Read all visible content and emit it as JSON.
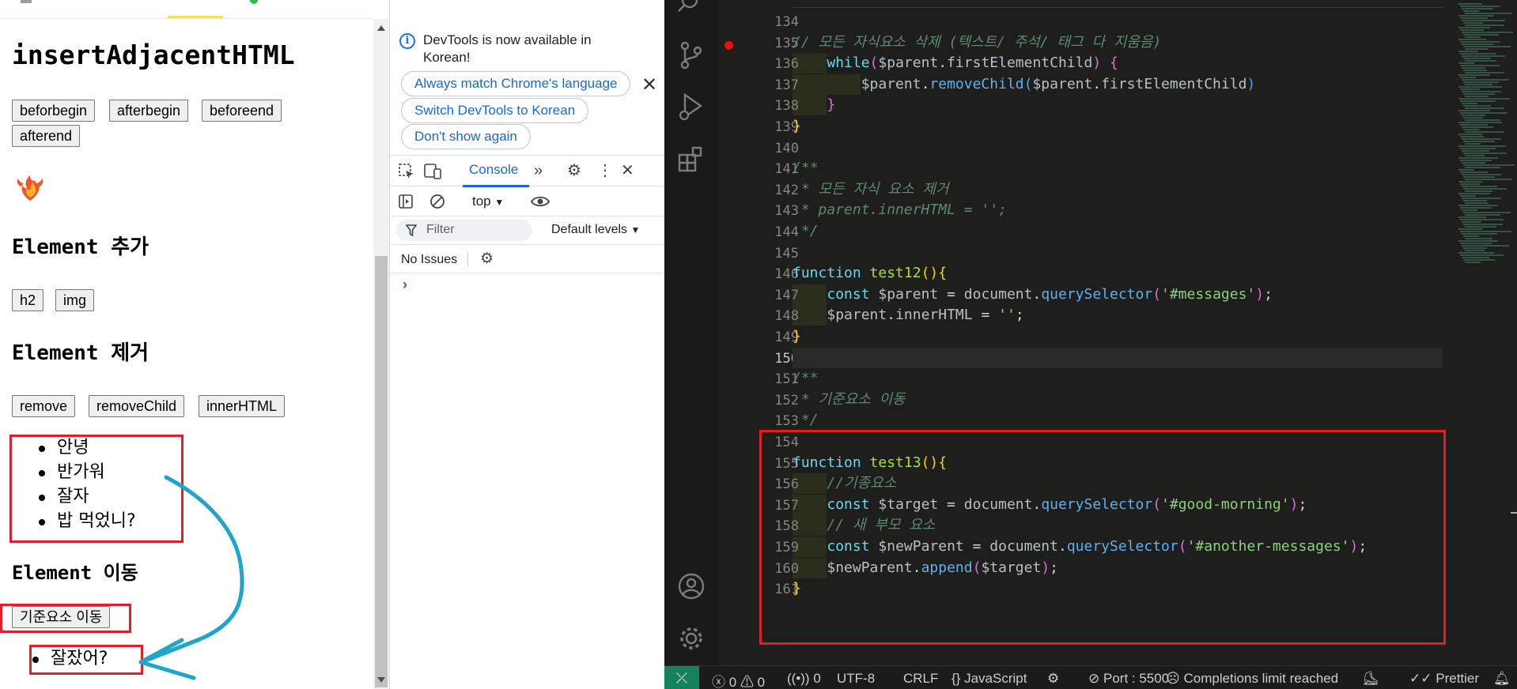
{
  "browser_page": {
    "heading_insert": "insertAdjacentHTML",
    "insert_buttons": [
      "beforbegin",
      "afterbegin",
      "beforeend",
      "afterend"
    ],
    "heading_add": "Element 추가",
    "add_buttons": [
      "h2",
      "img"
    ],
    "heading_remove": "Element 제거",
    "remove_buttons": [
      "remove",
      "removeChild",
      "innerHTML"
    ],
    "messages": [
      "안녕",
      "반가워",
      "잘자",
      "밥 먹었니?"
    ],
    "heading_move": "Element 이동",
    "move_button": "기준요소 이동",
    "another_messages": [
      "잘잤어?"
    ]
  },
  "devtools": {
    "notice_text": "DevTools is now available in Korean!",
    "notice_buttons": [
      "Always match Chrome's language",
      "Switch DevTools to Korean",
      "Don't show again"
    ],
    "tab_console": "Console",
    "context": "top",
    "filter_placeholder": "Filter",
    "levels": "Default levels",
    "issues": "No Issues"
  },
  "editor": {
    "lines": [
      {
        "n": "134",
        "html": ""
      },
      {
        "n": "135",
        "html": "<span class='cm'>// 모든 자식요소 삭제 (텍스트/ 주석/ 태그 다 지움음)</span>"
      },
      {
        "n": "136",
        "html": "    <span class='kw'>while</span><span class='br2'>(</span><span class='var'>$parent</span>.<span class='var'>firstElementChild</span><span class='br2'>)</span> <span class='br2'>{</span>"
      },
      {
        "n": "137",
        "html": "        <span class='var'>$parent</span>.<span class='fnb'>removeChild</span><span class='br3'>(</span><span class='var'>$parent</span>.<span class='var'>firstElementChild</span><span class='br3'>)</span>"
      },
      {
        "n": "138",
        "html": "    <span class='br2'>}</span>"
      },
      {
        "n": "139",
        "html": "<span class='br1'>}</span>"
      },
      {
        "n": "140",
        "html": ""
      },
      {
        "n": "141",
        "html": "<span class='cm'>/**</span>"
      },
      {
        "n": "142",
        "html": "<span class='cm'> * 모든 자식 요소 제거</span>"
      },
      {
        "n": "143",
        "html": "<span class='cm'> * parent.innerHTML = '';</span>"
      },
      {
        "n": "144",
        "html": "<span class='cm'> */</span>"
      },
      {
        "n": "145",
        "html": ""
      },
      {
        "n": "146",
        "html": "<span class='kw2'>function</span> <span class='fn'>test12</span><span class='br1'>(){</span>"
      },
      {
        "n": "147",
        "html": "    <span class='kw'>const</span> <span class='var'>$parent</span> = <span class='var'>document</span>.<span class='fnb'>querySelector</span><span class='br2'>(</span><span class='str'>'#messages'</span><span class='br2'>)</span>;"
      },
      {
        "n": "148",
        "html": "    <span class='var'>$parent</span>.<span class='var'>innerHTML</span> = <span class='str'>''</span>;"
      },
      {
        "n": "149",
        "html": "<span class='br1'>}</span>"
      },
      {
        "n": "150",
        "html": ""
      },
      {
        "n": "151",
        "html": "<span class='cm'>/**</span>"
      },
      {
        "n": "152",
        "html": "<span class='cm'> * 기준요소 이동</span>"
      },
      {
        "n": "153",
        "html": "<span class='cm'> */</span>"
      },
      {
        "n": "154",
        "html": ""
      },
      {
        "n": "155",
        "html": "<span class='kw2'>function</span> <span class='fn'>test13</span><span class='br1'>(){</span>"
      },
      {
        "n": "156",
        "html": "    <span class='cm'>//기종요소</span>"
      },
      {
        "n": "157",
        "html": "    <span class='kw'>const</span> <span class='var'>$target</span> = <span class='var'>document</span>.<span class='fnb'>querySelector</span><span class='br2'>(</span><span class='str'>'#good-morning'</span><span class='br2'>)</span>;"
      },
      {
        "n": "158",
        "html": "    <span class='cm'>// 새 부모 요소</span>"
      },
      {
        "n": "159",
        "html": "    <span class='kw'>const</span> <span class='var'>$newParent</span> = <span class='var'>document</span>.<span class='fnb'>querySelector</span><span class='br2'>(</span><span class='str'>'#another-messages'</span><span class='br2'>)</span>;"
      },
      {
        "n": "160",
        "html": "    <span class='var'>$newParent</span>.<span class='fnb'>append</span><span class='br2'>(</span><span class='var'>$target</span><span class='br2'>)</span>;"
      },
      {
        "n": "161",
        "html": "<span class='br1'>}</span>"
      }
    ],
    "active_line": "150",
    "breakpoint_line": "135"
  },
  "statusbar": {
    "problems": "0",
    "warnings": "0",
    "ports_forwarded": "0",
    "encoding": "UTF-8",
    "eol": "CRLF",
    "language": "JavaScript",
    "port": "Port : 5500",
    "completions": "Completions limit reached",
    "prettier": "Prettier"
  },
  "colors": {
    "annotation_red": "#e01f26",
    "arrow_blue": "#1ea5c9",
    "accent_blue": "#1a67d2"
  }
}
